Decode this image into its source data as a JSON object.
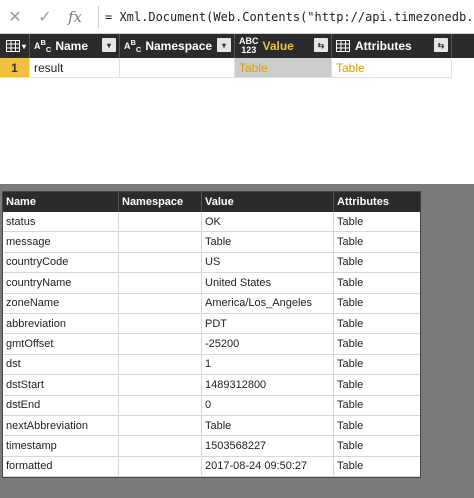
{
  "formula_bar": {
    "cancel_icon": "close-icon",
    "commit_icon": "check-icon",
    "fx_label": "fx",
    "formula": "= Xml.Document(Web.Contents(\"http://api.timezonedb.com/"
  },
  "top_table": {
    "columns": [
      {
        "type_icon": "table-icon",
        "label": ""
      },
      {
        "type_icon": "abc-icon",
        "label": "Name"
      },
      {
        "type_icon": "abc-icon",
        "label": "Namespace"
      },
      {
        "type_icon": "abc123-icon",
        "label": "Value"
      },
      {
        "type_icon": "table-icon",
        "label": "Attributes"
      }
    ],
    "rows": [
      {
        "index": "1",
        "name": "result",
        "namespace": "",
        "value": "Table",
        "attributes": "Table"
      }
    ]
  },
  "preview_table": {
    "headers": [
      "Name",
      "Namespace",
      "Value",
      "Attributes"
    ],
    "rows": [
      [
        "status",
        "",
        "OK",
        "Table"
      ],
      [
        "message",
        "",
        "Table",
        "Table"
      ],
      [
        "countryCode",
        "",
        "US",
        "Table"
      ],
      [
        "countryName",
        "",
        "United States",
        "Table"
      ],
      [
        "zoneName",
        "",
        "America/Los_Angeles",
        "Table"
      ],
      [
        "abbreviation",
        "",
        "PDT",
        "Table"
      ],
      [
        "gmtOffset",
        "",
        "-25200",
        "Table"
      ],
      [
        "dst",
        "",
        "1",
        "Table"
      ],
      [
        "dstStart",
        "",
        "1489312800",
        "Table"
      ],
      [
        "dstEnd",
        "",
        "0",
        "Table"
      ],
      [
        "nextAbbreviation",
        "",
        "Table",
        "Table"
      ],
      [
        "timestamp",
        "",
        "1503568227",
        "Table"
      ],
      [
        "formatted",
        "",
        "2017-08-24 09:50:27",
        "Table"
      ]
    ]
  }
}
